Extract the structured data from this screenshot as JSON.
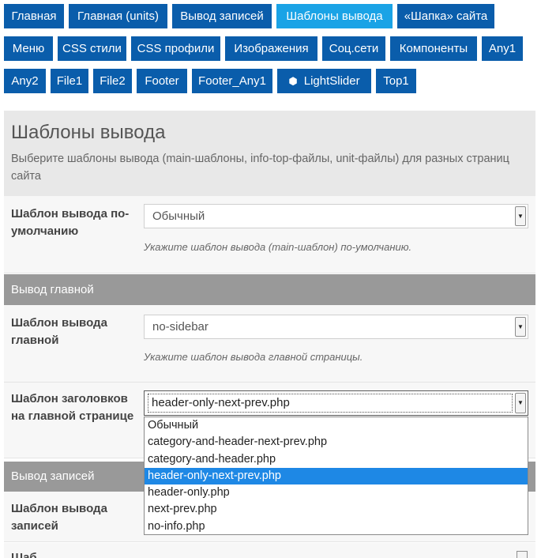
{
  "tabs": {
    "row1": [
      "Главная",
      "Главная (units)",
      "Вывод записей",
      "Шаблоны вывода",
      "«Шапка» сайта"
    ],
    "row2": [
      "Меню",
      "CSS стили",
      "CSS профили",
      "Изображения",
      "Соц.сети",
      "Компоненты",
      "Any1"
    ],
    "row3": [
      "Any2",
      "File1",
      "File2",
      "Footer",
      "Footer_Any1",
      "LightSlider",
      "Top1"
    ],
    "active": "Шаблоны вывода"
  },
  "header": {
    "title": "Шаблоны вывода",
    "description": "Выберите шаблоны вывода (main-шаблоны, info-top-файлы, unit-файлы) для разных страниц сайта"
  },
  "fields": {
    "default_template": {
      "label": "Шаблон вывода по-умолчанию",
      "value": "Обычный",
      "hint": "Укажите шаблон вывода (main-шаблон) по-умолчанию."
    },
    "home_template": {
      "label": "Шаблон вывода главной",
      "value": "no-sidebar",
      "hint": "Укажите шаблон вывода главной страницы."
    },
    "home_header": {
      "label": "Шаблон заголовков на главной странице",
      "value": "header-only-next-prev.php",
      "options": [
        "Обычный",
        "category-and-header-next-prev.php",
        "category-and-header.php",
        "header-only-next-prev.php",
        "header-only.php",
        "next-prev.php",
        "no-info.php"
      ],
      "selected_index": 3
    },
    "posts_template": {
      "label": "Шаблон вывода записей"
    },
    "next_label": "Шаб"
  },
  "sections": {
    "home": "Вывод главной",
    "posts": "Вывод записей"
  },
  "colors": {
    "tab": "#0a5dab",
    "tab_active": "#1aa3e6",
    "section_bar": "#999999",
    "selected_option": "#1e88e5"
  }
}
